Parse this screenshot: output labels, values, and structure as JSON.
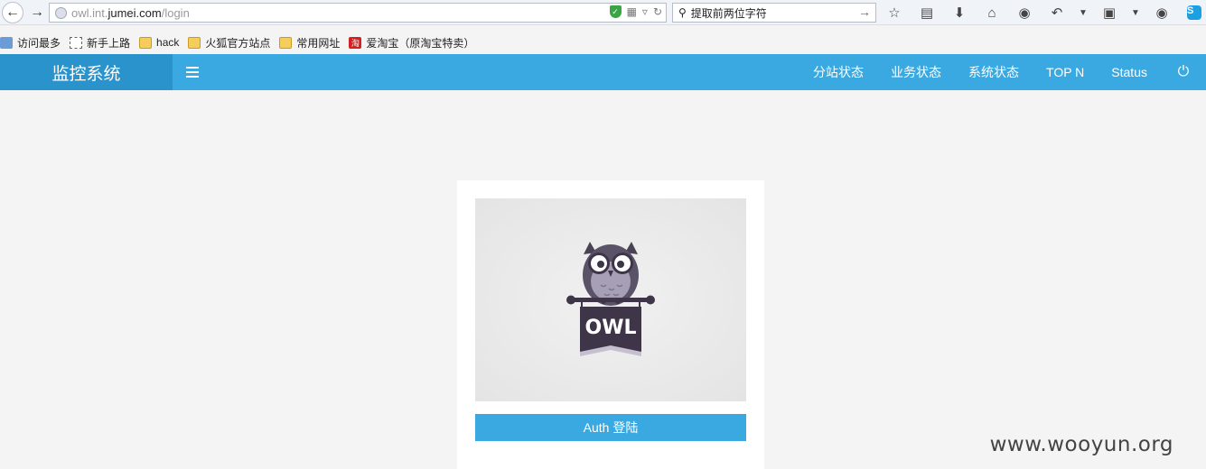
{
  "browser": {
    "url_host": "owl.int.",
    "url_main": "jumei.com",
    "url_path": "/login",
    "search_placeholder": "提取前两位字符"
  },
  "bookmarks": [
    {
      "label": "访问最多",
      "icon": "most-visited-icon"
    },
    {
      "label": "新手上路",
      "icon": "getting-started-icon"
    },
    {
      "label": "hack",
      "icon": "folder-icon"
    },
    {
      "label": "火狐官方站点",
      "icon": "folder-icon"
    },
    {
      "label": "常用网址",
      "icon": "folder-icon"
    },
    {
      "label": "爱淘宝（原淘宝特卖）",
      "icon": "taobao-icon"
    }
  ],
  "header": {
    "brand": "监控系统",
    "nav": [
      "分站状态",
      "业务状态",
      "系统状态",
      "TOP N",
      "Status"
    ]
  },
  "login": {
    "logo_text": "OWL",
    "button_label": "Auth 登陆"
  },
  "watermark": "www.wooyun.org",
  "colors": {
    "header_bg": "#3aa9e1",
    "brand_bg": "#2a93cc",
    "button_bg": "#3aa9e1",
    "owl_banner": "#3e3648"
  }
}
